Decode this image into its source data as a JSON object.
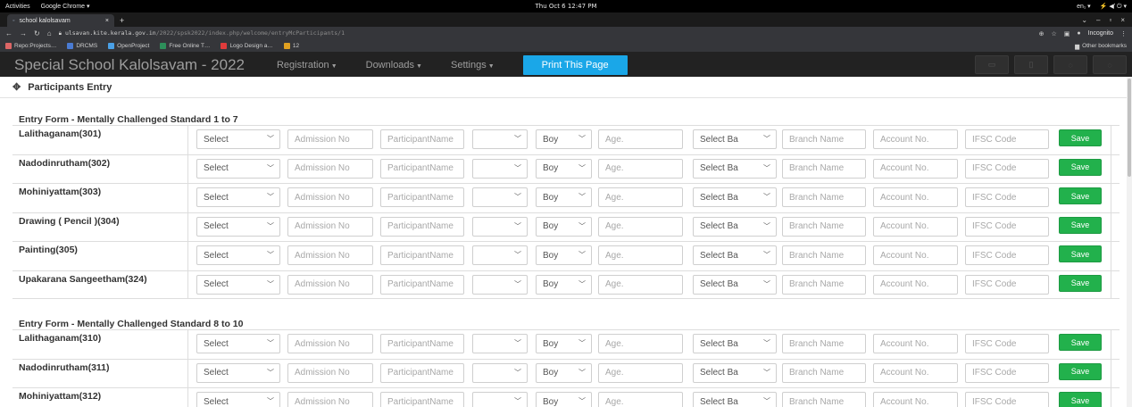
{
  "os": {
    "activities": "Activities",
    "app": "Google Chrome ▾",
    "datetime": "Thu Oct 6 12:47 PM",
    "lang": "en₁ ▾",
    "tray": "⚡ ◀ʹ ⏻ ▾"
  },
  "browser": {
    "tab_title": "school kalolsavam",
    "tab_close": "×",
    "new_tab": "+",
    "url_host": "ulsavan.kite.kerala.gov.in",
    "url_path": "/2022/spsk2022/index.php/welcome/entryMcParticipants/1",
    "incognito": "Incognito",
    "bookmarks": [
      {
        "label": "Repo:Projects…",
        "color": "#d66"
      },
      {
        "label": "DRCMS",
        "color": "#4a7bd3"
      },
      {
        "label": "OpenProject",
        "color": "#4aa0e6"
      },
      {
        "label": "Free Online T…",
        "color": "#2d8f5a"
      },
      {
        "label": "Logo Design a…",
        "color": "#e03b3b"
      },
      {
        "label": "12",
        "color": "#e0a020"
      }
    ],
    "other_bookmarks": "Other bookmarks"
  },
  "navbar": {
    "brand": "Special School Kalolsavam - 2022",
    "registration": "Registration",
    "downloads": "Downloads",
    "settings": "Settings",
    "print": "Print This Page"
  },
  "page": {
    "heading": "Participants Entry"
  },
  "form_labels": {
    "select_class": "Select",
    "admission_ph": "Admission No",
    "participant_ph": "ParticipantName",
    "gender": "Boy",
    "age_ph": "Age.",
    "bank": "Select Ba",
    "branch_ph": "Branch Name",
    "account_ph": "Account No.",
    "ifsc_ph": "IFSC Code",
    "save": "Save"
  },
  "sections": [
    {
      "title": "Entry Form - Mentally Challenged Standard 1 to 7",
      "items": [
        "Lalithaganam(301)",
        "Nadodinrutham(302)",
        "Mohiniyattam(303)",
        "Drawing ( Pencil )(304)",
        "Painting(305)",
        "Upakarana Sangeetham(324)"
      ]
    },
    {
      "title": "Entry Form - Mentally Challenged Standard 8 to 10",
      "items": [
        "Lalithaganam(310)",
        "Nadodinrutham(311)",
        "Mohiniyattam(312)"
      ]
    }
  ]
}
